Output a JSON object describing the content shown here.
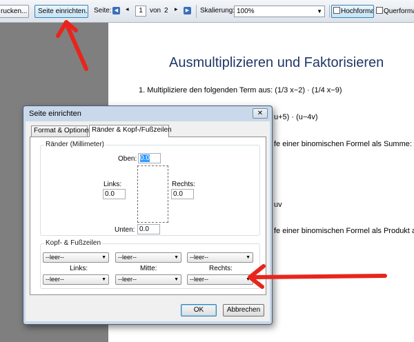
{
  "toolbar": {
    "print_label": "rucken...",
    "page_setup_label": "Seite einrichten...",
    "page_label": "Seite:",
    "page_current": "1",
    "page_of": "von",
    "page_total": "2",
    "scale_label": "Skalierung:",
    "scale_value": "100%",
    "portrait_label": "Hochformat",
    "landscape_label": "Querformat"
  },
  "document": {
    "title": "Ausmultiplizieren und Faktorisieren",
    "line1": "1. Multipliziere den folgenden Term aus: (1/3 x−2) · (1/4 x−9)",
    "line2": "u+5) · (u−4v)",
    "line3": "fe einer binomischen Formel als Summe:",
    "line4": "uv",
    "line5": "fe einer binomischen Formel als Produkt a"
  },
  "dialog": {
    "title": "Seite einrichten",
    "close_glyph": "✕",
    "tabs": [
      "Format & Optionen",
      "Ränder & Kopf-/Fußzeilen"
    ],
    "margins_group": "Ränder (Millimeter)",
    "top_label": "Oben:",
    "top_value": "0.0",
    "left_label": "Links:",
    "left_value": "0.0",
    "right_label": "Rechts:",
    "right_value": "0.0",
    "bottom_label": "Unten:",
    "bottom_value": "0.0",
    "hf_group": "Kopf- & Fußzeilen",
    "header_left": "--leer--",
    "header_center": "--leer--",
    "header_right": "--leer--",
    "col_left": "Links:",
    "col_center": "Mitte:",
    "col_right": "Rechts:",
    "footer_left": "--leer--",
    "footer_center": "--leer--",
    "footer_right": "--leer--",
    "ok_label": "OK",
    "cancel_label": "Abbrechen"
  },
  "colors": {
    "annotation_arrow": "#e8251c",
    "title_color": "#1f3864"
  }
}
